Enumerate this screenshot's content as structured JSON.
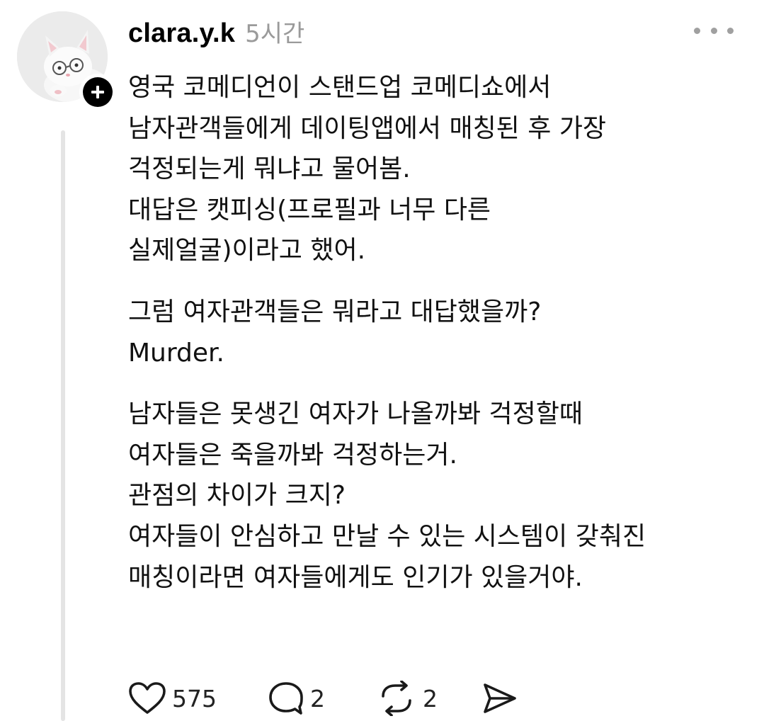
{
  "post": {
    "username": "clara.y.k",
    "time": "5시간",
    "paragraphs": [
      [
        "영국 코메디언이 스탠드업 코메디쇼에서",
        "남자관객들에게 데이팅앱에서 매칭된 후 가장",
        "걱정되는게 뭐냐고 물어봄.",
        "대답은 캣피싱(프로필과 너무 다른",
        "실제얼굴)이라고 했어."
      ],
      [
        "그럼 여자관객들은 뭐라고 대답했을까?",
        "Murder."
      ],
      [
        "남자들은 못생긴 여자가 나올까봐 걱정할때",
        "여자들은 죽을까봐 걱정하는거.",
        "관점의 차이가 크지?",
        "여자들이 안심하고 만날 수 있는 시스템이 갖춰진",
        "매칭이라면 여자들에게도 인기가 있을거야."
      ]
    ]
  },
  "actions": {
    "likes": "575",
    "replies": "2",
    "reposts": "2"
  },
  "icons": {
    "avatar": "white-cat-with-glasses-icon",
    "follow": "plus-icon",
    "more": "more-horizontal-icon",
    "like": "heart-icon",
    "reply": "speech-bubble-icon",
    "repost": "repost-arrows-icon",
    "share": "send-icon"
  },
  "colors": {
    "text": "#000000",
    "muted": "#9a9a9a",
    "thread_line": "#e4e4e4"
  }
}
